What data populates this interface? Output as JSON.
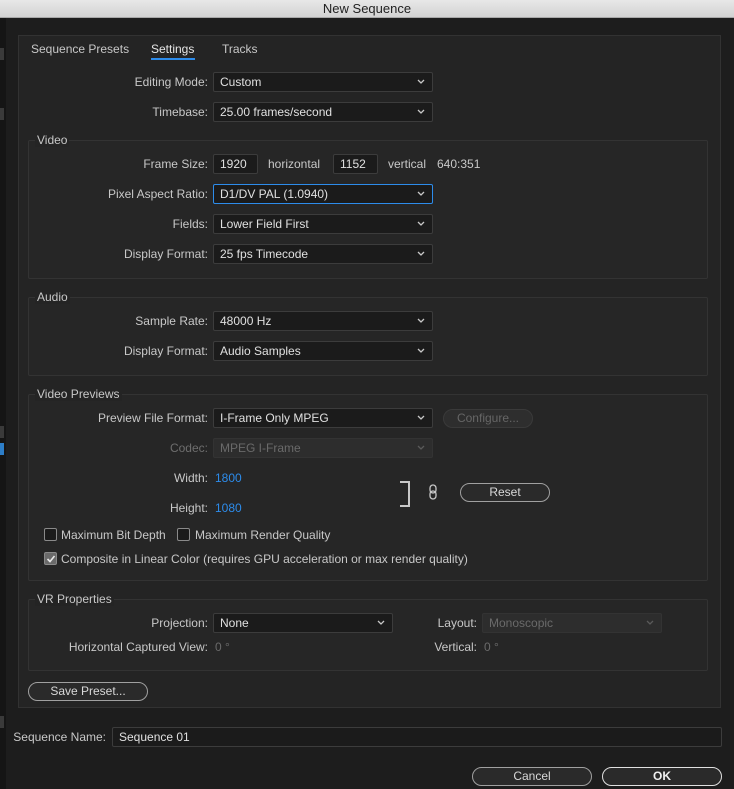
{
  "window": {
    "title": "New Sequence"
  },
  "tabs": [
    "Sequence Presets",
    "Settings",
    "Tracks"
  ],
  "general": {
    "editing_mode_label": "Editing Mode:",
    "editing_mode_value": "Custom",
    "timebase_label": "Timebase:",
    "timebase_value": "25.00  frames/second"
  },
  "video": {
    "title": "Video",
    "frame_size_label": "Frame Size:",
    "frame_width": "1920",
    "horizontal_label": "horizontal",
    "frame_height": "1152",
    "vertical_label": "vertical",
    "aspect_readout": "640:351",
    "pixel_aspect_label": "Pixel Aspect Ratio:",
    "pixel_aspect_value": "D1/DV PAL (1.0940)",
    "fields_label": "Fields:",
    "fields_value": "Lower Field First",
    "display_format_label": "Display Format:",
    "display_format_value": "25 fps Timecode"
  },
  "audio": {
    "title": "Audio",
    "sample_rate_label": "Sample Rate:",
    "sample_rate_value": "48000 Hz",
    "display_format_label": "Display Format:",
    "display_format_value": "Audio Samples"
  },
  "previews": {
    "title": "Video Previews",
    "file_format_label": "Preview File Format:",
    "file_format_value": "I-Frame Only MPEG",
    "configure_label": "Configure...",
    "codec_label": "Codec:",
    "codec_value": "MPEG I-Frame",
    "width_label": "Width:",
    "width_value": "1800",
    "height_label": "Height:",
    "height_value": "1080",
    "reset_label": "Reset",
    "max_bit_depth_label": "Maximum Bit Depth",
    "max_render_quality_label": "Maximum Render Quality",
    "linear_color_label": "Composite in Linear Color (requires GPU acceleration or max render quality)"
  },
  "vr": {
    "title": "VR Properties",
    "projection_label": "Projection:",
    "projection_value": "None",
    "layout_label": "Layout:",
    "layout_value": "Monoscopic",
    "h_view_label": "Horizontal Captured View:",
    "h_view_value": "0 °",
    "vertical_label": "Vertical:",
    "vertical_value": "0 °"
  },
  "save_preset_label": "Save Preset...",
  "sequence_name_label": "Sequence Name:",
  "sequence_name_value": "Sequence 01",
  "cancel_label": "Cancel",
  "ok_label": "OK",
  "colors": {
    "accent": "#2d8ceb",
    "panel": "#242424",
    "background": "#1d1d1d"
  },
  "icons": [
    "chevron-down-icon",
    "link-icon",
    "checkmark-icon"
  ]
}
